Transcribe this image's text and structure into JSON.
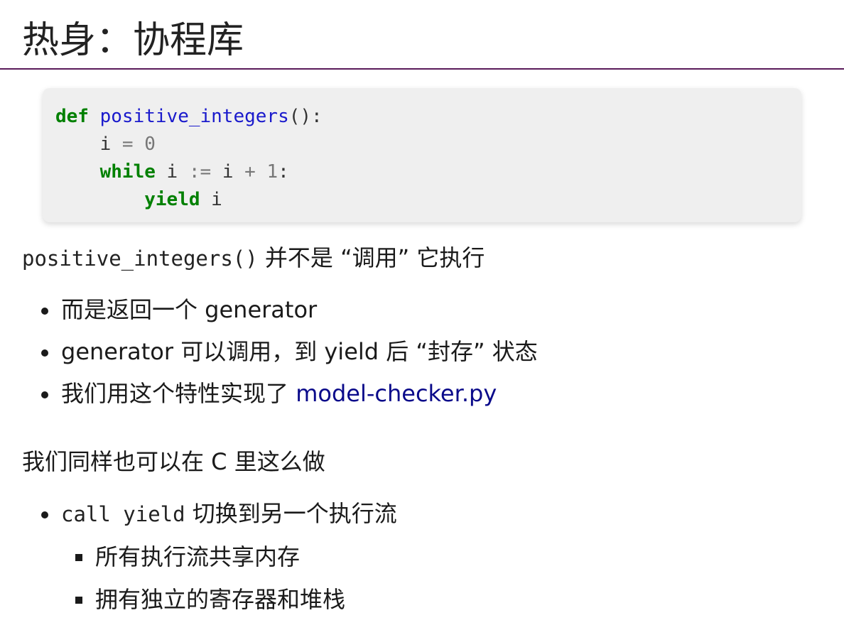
{
  "title": "热身：协程库",
  "code": {
    "line1": {
      "kw": "def",
      "fn": "positive_integers",
      "rest": "():"
    },
    "line2": {
      "indent": "    ",
      "var": "i",
      "op": " = ",
      "num": "0"
    },
    "line3": {
      "indent": "    ",
      "kw": "while",
      "var1": " i ",
      "op1": ":=",
      "var2": " i ",
      "op2": "+",
      "num": " 1",
      "colon": ":"
    },
    "line4": {
      "indent": "        ",
      "kw": "yield",
      "var": " i"
    }
  },
  "para1": {
    "code": "positive_integers()",
    "text": " 并不是 “调用” 它执行"
  },
  "bullets1": [
    {
      "text": "而是返回一个 generator"
    },
    {
      "text": "generator 可以调用，到 yield 后 “封存” 状态"
    },
    {
      "text": "我们用这个特性实现了 ",
      "link": "model-checker.py"
    }
  ],
  "para2": {
    "text": "我们同样也可以在 C 里这么做"
  },
  "bullets2": [
    {
      "code": "call yield",
      "text": " 切换到另一个执行流"
    }
  ],
  "sub_bullets": [
    {
      "text": "所有执行流共享内存"
    },
    {
      "text": "拥有独立的寄存器和堆栈"
    }
  ],
  "colors": {
    "title_rule": "#5a1a5a",
    "keyword": "#008000",
    "function": "#1a1acc",
    "link": "#0a0a8a"
  }
}
